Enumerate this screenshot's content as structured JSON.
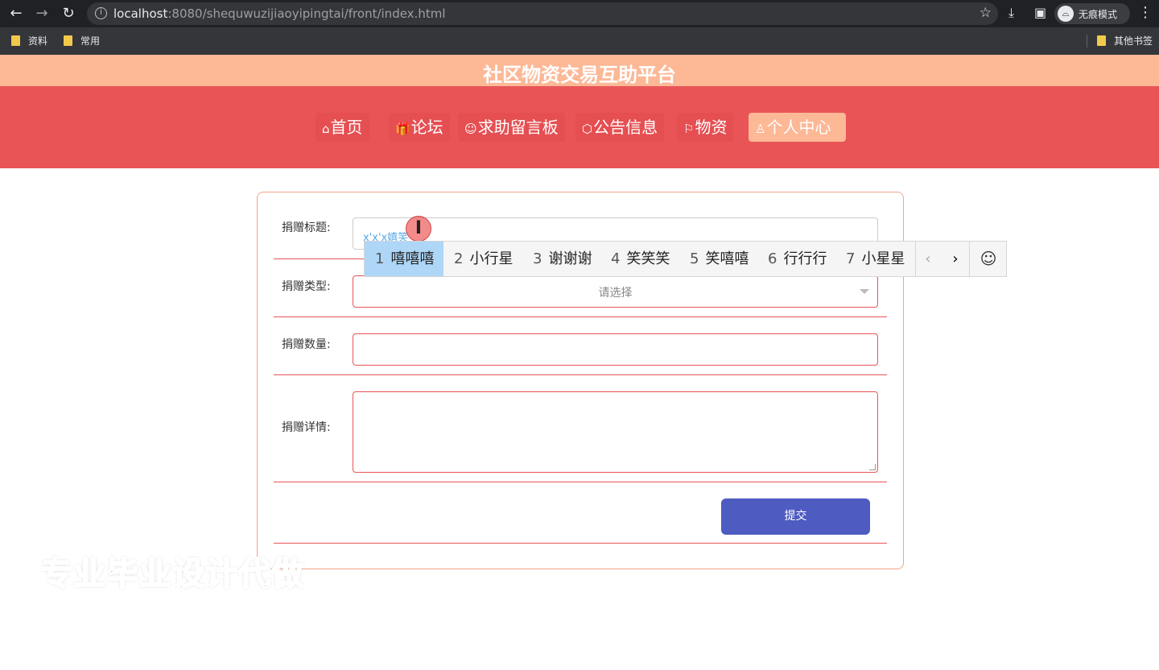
{
  "browser": {
    "url_host": "localhost",
    "url_rest": ":8080/shequwuzijiaoyipingtai/front/index.html",
    "incognito_label": "无痕模式",
    "bookmarks": [
      "资料",
      "常用"
    ],
    "other_bookmarks": "其他书签"
  },
  "site": {
    "title": "社区物资交易互助平台",
    "nav": [
      {
        "icon": "⌂",
        "label": "首页"
      },
      {
        "icon": "🎁",
        "label": "论坛"
      },
      {
        "icon": "☺",
        "label": "求助留言板"
      },
      {
        "icon": "⬡",
        "label": "公告信息"
      },
      {
        "icon": "⚐",
        "label": "物资"
      },
      {
        "icon": "♙",
        "label": "个人中心"
      }
    ],
    "active_nav": "个人中心"
  },
  "form": {
    "title_label": "捐赠标题:",
    "title_value": "x'x'x嬉笑",
    "type_label": "捐赠类型:",
    "type_placeholder": "请选择",
    "quantity_label": "捐赠数量:",
    "quantity_value": "",
    "details_label": "捐赠详情:",
    "details_value": "",
    "submit_label": "提交"
  },
  "ime": {
    "candidates": [
      {
        "num": "1",
        "text": "嘻嘻嘻"
      },
      {
        "num": "2",
        "text": "小行星"
      },
      {
        "num": "3",
        "text": "谢谢谢"
      },
      {
        "num": "4",
        "text": "笑笑笑"
      },
      {
        "num": "5",
        "text": "笑嘻嘻"
      },
      {
        "num": "6",
        "text": "行行行"
      },
      {
        "num": "7",
        "text": "小星星"
      }
    ],
    "prev": "‹",
    "next": "›",
    "emoji": "☺"
  },
  "watermark": "专业毕业设计代做",
  "colors": {
    "title_bar": "#fdb896",
    "nav_bar": "#e95457",
    "submit": "#4e5bc1",
    "ime_selected": "#add6f7"
  }
}
